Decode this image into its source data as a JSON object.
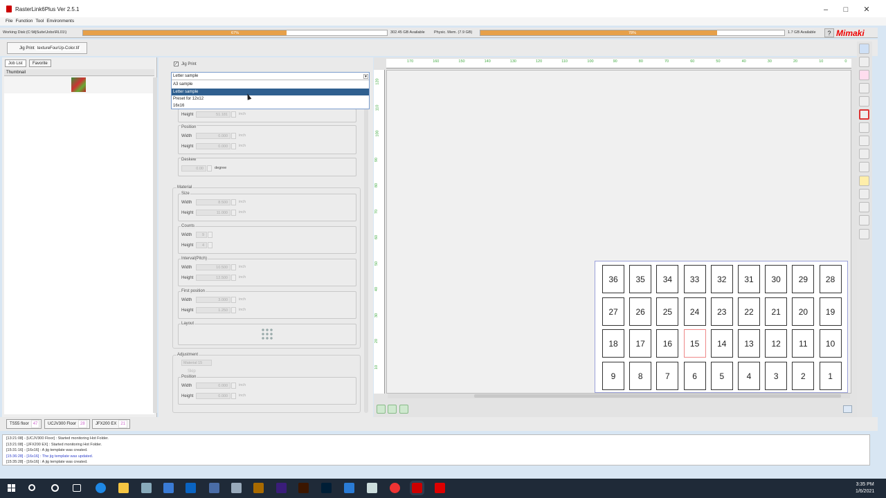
{
  "window": {
    "title": "RasterLink6Plus Ver 2.5.1"
  },
  "menu": [
    "File",
    "Function",
    "Tool",
    "Environments"
  ],
  "status": {
    "working_disk_label": "Working Disk:(C:\\MjSuite\\Jobs\\RL01\\)",
    "disk_percent": 67,
    "disk_percent_label": "67%",
    "disk_available": "302.45 GB Available",
    "mem_label": "Physic. Mem. (7.9 GB)",
    "mem_percent": 78,
    "mem_percent_label": "78%",
    "mem_available": "1.7 GB Available",
    "help": "?",
    "logo": "Mimaki",
    "bar_color": "#e6a04a"
  },
  "function_tab": {
    "label": "Jig Print",
    "file": "textureFourUp-Color.tif"
  },
  "left_panel": {
    "tabs": [
      "Job List",
      "Favorite"
    ],
    "thumbnail_header": "Thumbnail"
  },
  "settings": {
    "jig_print_label": "Jig Print",
    "template": {
      "selected": "Letter sample",
      "options": [
        "A3 sample",
        "Letter sample",
        "Preset for 12x12",
        "16x16"
      ]
    },
    "top_height": {
      "label": "Height",
      "value": "51.181",
      "unit": "inch"
    },
    "position": {
      "label": "Position",
      "width_label": "Width",
      "width": "0.000",
      "height_label": "Height",
      "height": "0.000",
      "unit": "inch"
    },
    "deskew": {
      "label": "Deskew",
      "value": "0.00",
      "unit": "degree"
    },
    "material": {
      "label": "Material",
      "size": {
        "label": "Size",
        "width_label": "Width",
        "width": "8.500",
        "height_label": "Height",
        "height": "11.000",
        "unit": "inch"
      },
      "counts": {
        "label": "Counts",
        "width_label": "Width",
        "width": "9",
        "height_label": "Height",
        "height": "4"
      },
      "interval": {
        "label": "Interval(Pitch)",
        "width_label": "Width",
        "width": "10.500",
        "height_label": "Height",
        "height": "12.500",
        "unit": "inch"
      },
      "first_position": {
        "label": "First position",
        "width_label": "Width",
        "width": "3.000",
        "height_label": "Height",
        "height": "1.250",
        "unit": "inch"
      },
      "layout": {
        "label": "Layout"
      }
    },
    "adjustment": {
      "label": "Adjustment",
      "material_select": "Material 15",
      "skip_label": "Skip",
      "position": {
        "label": "Position",
        "width_label": "Width",
        "width": "0.000",
        "height_label": "Height",
        "height": "0.000",
        "unit": "inch"
      }
    }
  },
  "ruler": {
    "top": [
      "170",
      "160",
      "150",
      "140",
      "130",
      "120",
      "110",
      "100",
      "90",
      "80",
      "70",
      "60",
      "50",
      "40",
      "30",
      "20",
      "10",
      "0"
    ],
    "left": [
      "120",
      "110",
      "100",
      "90",
      "80",
      "70",
      "60",
      "50",
      "40",
      "30",
      "20",
      "10"
    ]
  },
  "jig_grid": [
    [
      "36",
      "35",
      "34",
      "33",
      "32",
      "31",
      "30",
      "29",
      "28"
    ],
    [
      "27",
      "26",
      "25",
      "24",
      "23",
      "22",
      "21",
      "20",
      "19"
    ],
    [
      "18",
      "17",
      "16",
      "15",
      "14",
      "13",
      "12",
      "11",
      "10"
    ],
    [
      "9",
      "8",
      "7",
      "6",
      "5",
      "4",
      "3",
      "2",
      "1"
    ]
  ],
  "highlight_cell": "15",
  "printers": [
    {
      "name": "TS55 floor",
      "count": "47"
    },
    {
      "name": "UCJV300 Floor",
      "count": "28"
    },
    {
      "name": "JFX200 EX",
      "count": "21"
    }
  ],
  "log": [
    {
      "text": "[13:21:08] - [UCJV300 Floor] : Started monitoring Hot Folder.",
      "color": "#333"
    },
    {
      "text": "[13:21:08] - [JFX200 EX] : Started monitoring Hot Folder.",
      "color": "#333"
    },
    {
      "text": "[15:31:16] - [16x16] : A jig template was created.",
      "color": "#333"
    },
    {
      "text": "[15:36:28] - [16x16] : The jig template was updated.",
      "color": "#3344cc"
    },
    {
      "text": "[15:35:28] - [16x16] : A jig template was created.",
      "color": "#333"
    }
  ],
  "clock": {
    "time": "3:35 PM",
    "date": "1/6/2021"
  }
}
